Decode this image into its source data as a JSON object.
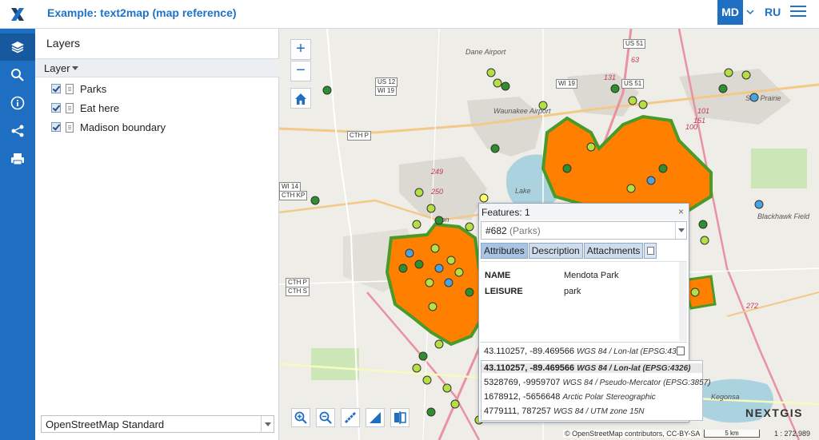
{
  "header": {
    "logo_icon": "x-logo-icon",
    "title": "Example: text2map (map reference)",
    "lang_active": "MD",
    "lang_other": "RU",
    "menu_icon": "hamburger-icon"
  },
  "rail": {
    "items": [
      {
        "icon": "layers-icon",
        "active": true
      },
      {
        "icon": "search-icon",
        "active": false
      },
      {
        "icon": "info-icon",
        "active": false
      },
      {
        "icon": "share-icon",
        "active": false
      },
      {
        "icon": "print-icon",
        "active": false
      }
    ]
  },
  "layers_panel": {
    "title": "Layers",
    "column_header": "Layer",
    "layers": [
      {
        "name": "Parks",
        "checked": true
      },
      {
        "name": "Eat here",
        "checked": true
      },
      {
        "name": "Madison boundary",
        "checked": true
      }
    ],
    "basemap": "OpenStreetMap Standard"
  },
  "map": {
    "zoom_in": "+",
    "zoom_out": "−",
    "home_icon": "home-icon",
    "labels": {
      "dane_airport": "Dane Airport",
      "waunakee_airport": "Waunakee Airport",
      "blackhawk_field": "Blackhawk Field",
      "kegonsa": "Kegonsa",
      "lake": "Lake",
      "nton": "nton",
      "sun_prairie": "Sun Prairie",
      "us51": "US 51",
      "us12": "US 12",
      "wi19": "WI 19",
      "wi19b": "WI 19",
      "us51b": "US 51",
      "cthp": "CTH P",
      "cthp2": "CTH P",
      "cths": "CTH S",
      "cthkp": "CTH KP",
      "wi14": "WI 14",
      "r249": "249",
      "r250": "250",
      "r101": "101",
      "r100": "100",
      "r151": "151",
      "r272": "272",
      "r63": "63",
      "r131": "131"
    },
    "colors": {
      "park_fill": "#ff8000",
      "boundary_stroke": "#4a9a2a",
      "point_light": "#b4e046",
      "point_dark": "#2f8f2f",
      "point_blue": "#4aa3df"
    },
    "tools": [
      "zoom-in-box-icon",
      "zoom-out-box-icon",
      "measure-distance-icon",
      "measure-area-icon",
      "swipe-icon"
    ],
    "nextgis_logo": "NEXTGIS",
    "attribution": "© OpenStreetMap contributors, CC-BY-SA",
    "scale": "5 km",
    "scale_ratio": "1 : 272,989"
  },
  "popup": {
    "title": "Features: 1",
    "close": "×",
    "feature_id": "#682",
    "feature_layer": "(Parks)",
    "tabs": [
      "Attributes",
      "Description",
      "Attachments"
    ],
    "active_tab": "Attributes",
    "attributes": [
      {
        "key": "NAME",
        "value": "Mendota Park"
      },
      {
        "key": "LEISURE",
        "value": "park"
      }
    ],
    "coord_current": "43.110257, -89.469566",
    "coord_current_crs": "WGS 84 / Lon-lat (EPSG:43...",
    "coord_options": [
      {
        "value": "43.110257, -89.469566",
        "crs": "WGS 84 / Lon-lat (EPSG:4326)",
        "selected": true
      },
      {
        "value": "5328769, -9959707",
        "crs": "WGS 84 / Pseudo-Mercator (EPSG:3857)",
        "selected": false
      },
      {
        "value": "1678912, -5656648",
        "crs": "Arctic Polar Stereographic",
        "selected": false
      },
      {
        "value": "4779111, 787257",
        "crs": "WGS 84 / UTM zone 15N",
        "selected": false
      }
    ]
  }
}
